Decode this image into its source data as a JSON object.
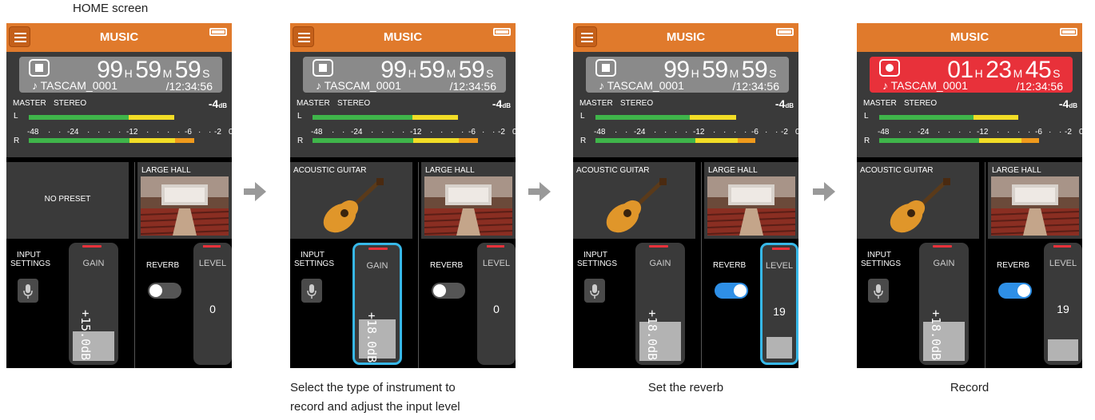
{
  "home_caption": "HOME screen",
  "captions": [
    "Select the type of instrument to",
    "record and adjust the input level",
    "Set the reverb",
    "Record"
  ],
  "screens": [
    {
      "title": "MUSIC",
      "hours": "99",
      "h": "H",
      "minutes": "59",
      "m": "M",
      "seconds": "59",
      "s": "S",
      "file": "♪ TASCAM_0001",
      "remain": "/12:34:56",
      "master": "MASTER",
      "stereo": "STEREO",
      "db": "-4",
      "db_unit": "dB",
      "l": "L",
      "r": "R",
      "preset": "NO PRESET",
      "hall": "LARGE HALL",
      "input_settings_1": "INPUT",
      "input_settings_2": "SETTINGS",
      "gain_label": "GAIN",
      "gain_value": "+15.0dB",
      "gain_level": 0.26,
      "reverb": "REVERB",
      "level_label": "LEVEL",
      "level_value": "0",
      "level_fill": 0,
      "reverb_on": false
    },
    {
      "title": "MUSIC",
      "hours": "99",
      "h": "H",
      "minutes": "59",
      "m": "M",
      "seconds": "59",
      "s": "S",
      "file": "♪ TASCAM_0001",
      "remain": "/12:34:56",
      "master": "MASTER",
      "stereo": "STEREO",
      "db": "-4",
      "db_unit": "dB",
      "l": "L",
      "r": "R",
      "preset": "ACOUSTIC GUITAR",
      "hall": "LARGE HALL",
      "input_settings_1": "INPUT",
      "input_settings_2": "SETTINGS",
      "gain_label": "GAIN",
      "gain_value": "+18.0dB",
      "gain_level": 0.34,
      "reverb": "REVERB",
      "level_label": "LEVEL",
      "level_value": "0",
      "level_fill": 0,
      "reverb_on": false
    },
    {
      "title": "MUSIC",
      "hours": "99",
      "h": "H",
      "minutes": "59",
      "m": "M",
      "seconds": "59",
      "s": "S",
      "file": "♪ TASCAM_0001",
      "remain": "/12:34:56",
      "master": "MASTER",
      "stereo": "STEREO",
      "db": "-4",
      "db_unit": "dB",
      "l": "L",
      "r": "R",
      "preset": "ACOUSTIC GUITAR",
      "hall": "LARGE HALL",
      "input_settings_1": "INPUT",
      "input_settings_2": "SETTINGS",
      "gain_label": "GAIN",
      "gain_value": "+18.0dB",
      "gain_level": 0.34,
      "reverb": "REVERB",
      "level_label": "LEVEL",
      "level_value": "19",
      "level_fill": 0.19,
      "reverb_on": true
    },
    {
      "title": "MUSIC",
      "hours": "01",
      "h": "H",
      "minutes": "23",
      "m": "M",
      "seconds": "45",
      "s": "S",
      "file": "♪ TASCAM_0001",
      "remain": "/12:34:56",
      "master": "MASTER",
      "stereo": "STEREO",
      "db": "-4",
      "db_unit": "dB",
      "l": "L",
      "r": "R",
      "preset": "ACOUSTIC GUITAR",
      "hall": "LARGE HALL",
      "input_settings_1": "INPUT",
      "input_settings_2": "SETTINGS",
      "gain_label": "GAIN",
      "gain_value": "+18.0dB",
      "gain_level": 0.34,
      "reverb": "REVERB",
      "level_label": "LEVEL",
      "level_value": "19",
      "level_fill": 0.19,
      "reverb_on": true
    }
  ],
  "scale": [
    "-48",
    "·",
    "·",
    "-24",
    "·",
    "·",
    "·",
    "·",
    "-12",
    "·",
    "·",
    "·",
    "·",
    "-6",
    "·",
    "·",
    "-2",
    "0"
  ],
  "colors": {
    "header": "#e07a2c",
    "recording": "#e8313a",
    "selected": "#37b8e8",
    "toggle_on": "#2e8fe6"
  }
}
